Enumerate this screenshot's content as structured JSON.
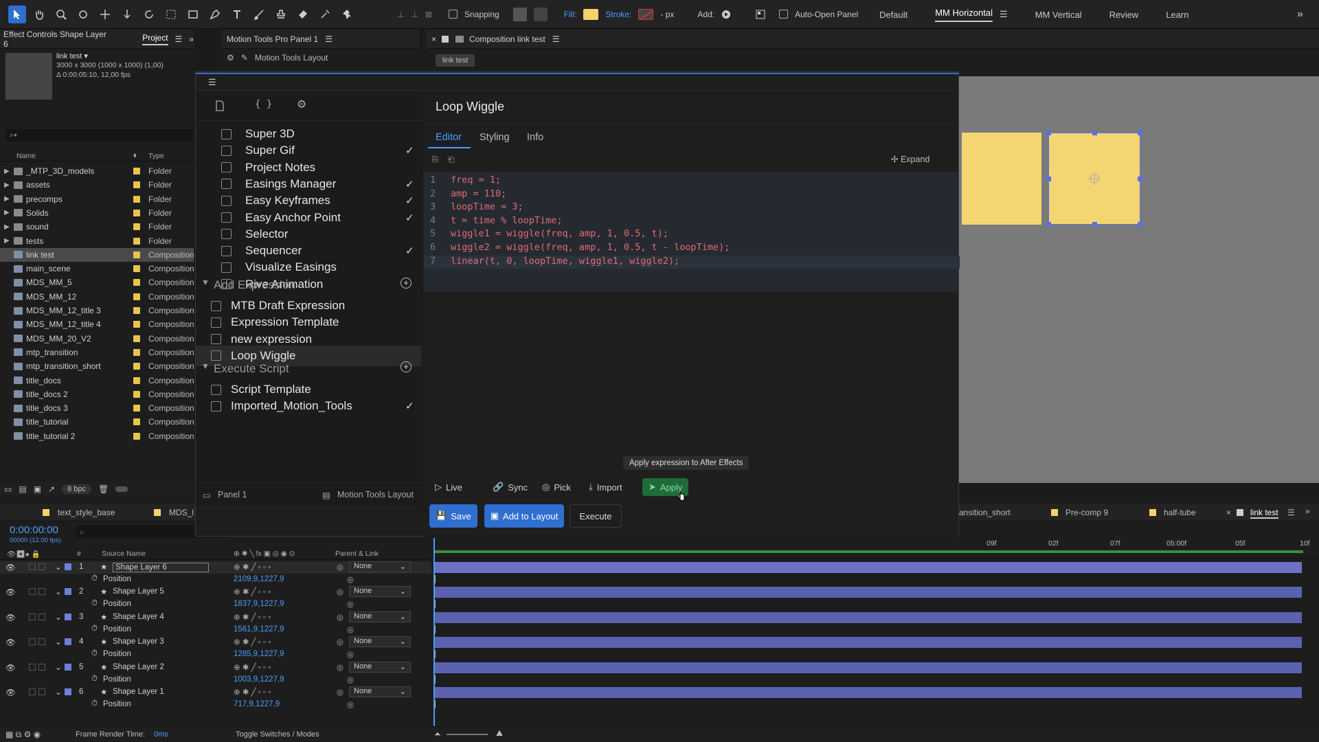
{
  "toolbar": {
    "snapping": "Snapping",
    "fill": "Fill:",
    "stroke": "Stroke:",
    "stroke_unit": "- px",
    "add": "Add:",
    "auto_open": "Auto-Open Panel",
    "colors": {
      "fill": "#f5d36a",
      "stroke": "#d33"
    }
  },
  "workspaces": [
    "Default",
    "MM Horizontal",
    "MM Vertical",
    "Review",
    "Learn"
  ],
  "effect_controls": {
    "tab": "Effect Controls Shape Layer 6",
    "project_tab": "Project",
    "comp_name": "link test ▾",
    "comp_size": "3000 x 3000 (1000 x 1000) (1,00)",
    "comp_dur": "Δ 0:00:05:10, 12,00 fps",
    "search_placeholder": "⌕▾"
  },
  "project": {
    "col_name": "Name",
    "col_type": "Type",
    "items": [
      {
        "name": "_MTP_3D_models",
        "type": "Folder",
        "kind": "folder"
      },
      {
        "name": "assets",
        "type": "Folder",
        "kind": "folder"
      },
      {
        "name": "precomps",
        "type": "Folder",
        "kind": "folder"
      },
      {
        "name": "Solids",
        "type": "Folder",
        "kind": "folder"
      },
      {
        "name": "sound",
        "type": "Folder",
        "kind": "folder"
      },
      {
        "name": "tests",
        "type": "Folder",
        "kind": "folder"
      },
      {
        "name": "link test",
        "type": "Composition",
        "kind": "comp"
      },
      {
        "name": "main_scene",
        "type": "Composition",
        "kind": "comp"
      },
      {
        "name": "MDS_MM_5",
        "type": "Composition",
        "kind": "comp"
      },
      {
        "name": "MDS_MM_12",
        "type": "Composition",
        "kind": "comp"
      },
      {
        "name": "MDS_MM_12_title 3",
        "type": "Composition",
        "kind": "comp"
      },
      {
        "name": "MDS_MM_12_title 4",
        "type": "Composition",
        "kind": "comp"
      },
      {
        "name": "MDS_MM_20_V2",
        "type": "Composition",
        "kind": "comp"
      },
      {
        "name": "mtp_transition",
        "type": "Composition",
        "kind": "comp"
      },
      {
        "name": "mtp_transition_short",
        "type": "Composition",
        "kind": "comp"
      },
      {
        "name": "title_docs",
        "type": "Composition",
        "kind": "comp"
      },
      {
        "name": "title_docs 2",
        "type": "Composition",
        "kind": "comp"
      },
      {
        "name": "title_docs 3",
        "type": "Composition",
        "kind": "comp"
      },
      {
        "name": "title_tutorial",
        "type": "Composition",
        "kind": "comp"
      },
      {
        "name": "title_tutorial 2",
        "type": "Composition",
        "kind": "comp"
      }
    ],
    "bpc": "8 bpc"
  },
  "motion_panel": {
    "tab": "Motion Tools Pro Panel 1",
    "layout_label": "Motion Tools Layout"
  },
  "composition": {
    "tab": "Composition link test",
    "subtab": "link test"
  },
  "modal": {
    "sidebar_items": [
      {
        "label": "Super 3D",
        "check": ""
      },
      {
        "label": "Super Gif",
        "check": "✓"
      },
      {
        "label": "Project Notes",
        "check": ""
      },
      {
        "label": "Easings Manager",
        "check": "✓"
      },
      {
        "label": "Easy Keyframes",
        "check": "✓"
      },
      {
        "label": "Easy Anchor Point",
        "check": "✓"
      },
      {
        "label": "Selector",
        "check": ""
      },
      {
        "label": "Sequencer",
        "check": "✓"
      },
      {
        "label": "Visualize Easings",
        "check": ""
      },
      {
        "label": "Rive Animation",
        "check": ""
      }
    ],
    "add_expression": "Add Expression",
    "expression_items": [
      {
        "label": "MTB Draft Expression"
      },
      {
        "label": "Expression Template"
      },
      {
        "label": "new expression"
      },
      {
        "label": "Loop Wiggle"
      }
    ],
    "execute_script": "Execute Script",
    "script_items": [
      {
        "label": "Script Template",
        "check": ""
      },
      {
        "label": "Imported_Motion_Tools",
        "check": "✓"
      }
    ],
    "footer_panel": "Panel 1",
    "footer_layout": "Motion Tools Layout",
    "title": "Loop Wiggle",
    "tabs": [
      "Editor",
      "Styling",
      "Info"
    ],
    "expand": "Expand",
    "code": [
      "freq = 1;",
      "amp = 110;",
      "loopTime = 3;",
      "t = time % loopTime;",
      "wiggle1 = wiggle(freq, amp, 1, 0.5, t);",
      "wiggle2 = wiggle(freq, amp, 1, 0.5, t - loopTime);",
      "linear(t, 0, loopTime, wiggle1, wiggle2);"
    ],
    "tooltip": "Apply expression to After Effects",
    "actions": [
      "Live",
      "Sync",
      "Pick",
      "Import",
      "Apply"
    ],
    "save": "Save",
    "add_to_layout": "Add to Layout",
    "execute": "Execute"
  },
  "timeline": {
    "tabs": [
      "text_style_base",
      "MDS_l"
    ],
    "right_tabs": [
      "ansition_short",
      "Pre-comp 9",
      "half-tube",
      "link test"
    ],
    "timecode": "0:00:00:00",
    "fps": "00000 (12.00 fps)",
    "col_source": "Source Name",
    "col_parent": "Parent & Link",
    "ruler": [
      "09f",
      "02f",
      "07f",
      "05:00f",
      "05f",
      "10f"
    ],
    "layers": [
      {
        "num": "1",
        "name": "Shape Layer 6",
        "parent": "None",
        "pos": "2109,9,1227,9"
      },
      {
        "num": "2",
        "name": "Shape Layer 5",
        "parent": "None",
        "pos": "1837,9,1227,9"
      },
      {
        "num": "3",
        "name": "Shape Layer 4",
        "parent": "None",
        "pos": "1561,9,1227,9"
      },
      {
        "num": "4",
        "name": "Shape Layer 3",
        "parent": "None",
        "pos": "1285,9,1227,9"
      },
      {
        "num": "5",
        "name": "Shape Layer 2",
        "parent": "None",
        "pos": "1003,9,1227,9"
      },
      {
        "num": "6",
        "name": "Shape Layer 1",
        "parent": "None",
        "pos": "717,9,1227,9"
      }
    ],
    "position_label": "Position",
    "frame_render_label": "Frame Render Time:",
    "frame_render_value": "0ms",
    "toggle": "Toggle Switches / Modes"
  }
}
